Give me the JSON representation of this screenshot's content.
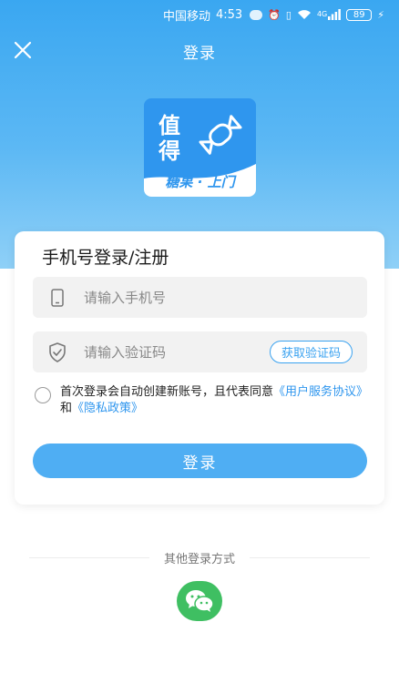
{
  "status_bar": {
    "carrier": "中国移动",
    "time": "4:53",
    "battery": "89",
    "network": "4G"
  },
  "header": {
    "title": "登录",
    "close_icon": "close-icon"
  },
  "logo": {
    "char1": "值",
    "char2": "得",
    "tagline": "糖果 · 上门"
  },
  "card": {
    "title": "手机号登录/注册",
    "phone_placeholder": "请输入手机号",
    "code_placeholder": "请输入验证码",
    "get_code_label": "获取验证码",
    "agreement_prefix": "首次登录会自动创建新账号，且代表同意",
    "user_agreement": "《用户服务协议》",
    "and": "和",
    "privacy_policy": "《隐私政策》",
    "login_label": "登录"
  },
  "other_login": {
    "label": "其他登录方式",
    "wechat_icon": "wechat-icon"
  },
  "colors": {
    "primary": "#3aa2f0",
    "button": "#4faef3",
    "wechat": "#3fbf62"
  }
}
